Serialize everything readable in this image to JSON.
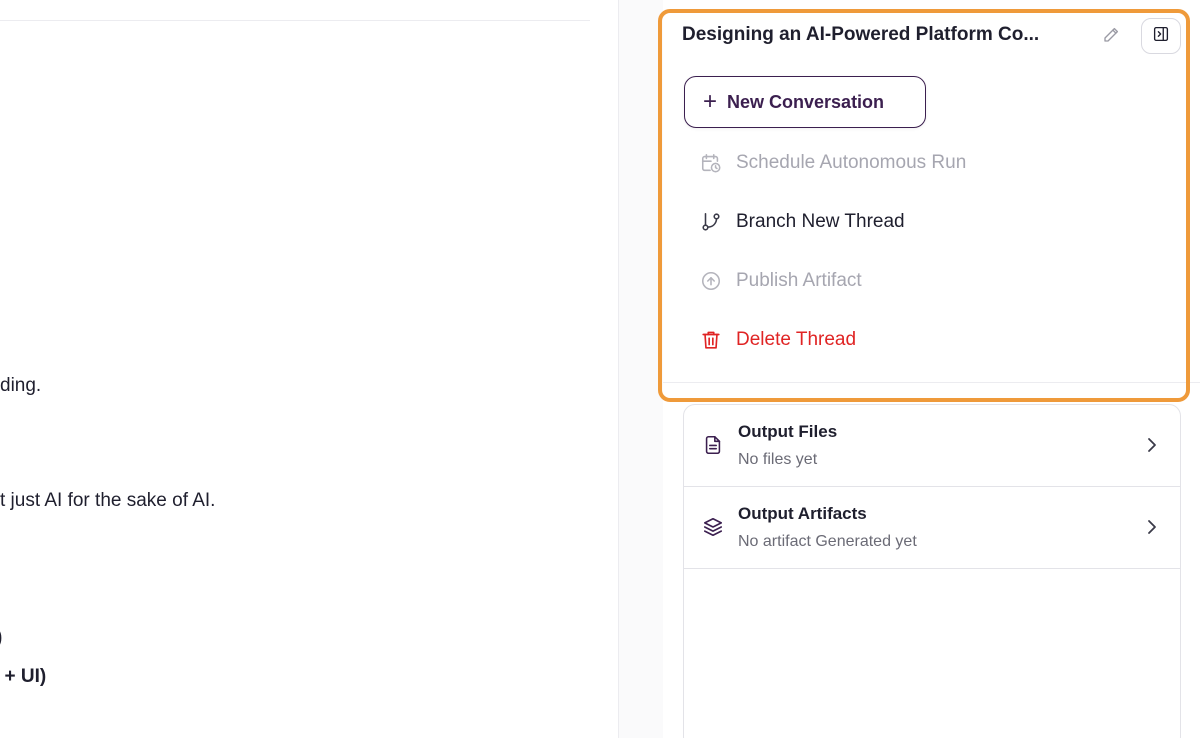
{
  "chat": {
    "lines": [
      "ding.",
      "t just AI for the sake of AI.",
      ")",
      ". + UI)"
    ]
  },
  "sidebar": {
    "thread_title": "Designing an AI-Powered Platform Co...",
    "new_conversation_label": "New Conversation",
    "menu": [
      {
        "label": "Schedule Autonomous Run",
        "icon": "calendar-clock-icon",
        "state": "disabled"
      },
      {
        "label": "Branch New Thread",
        "icon": "git-branch-icon",
        "state": "enabled"
      },
      {
        "label": "Publish Artifact",
        "icon": "upload-circle-icon",
        "state": "disabled"
      },
      {
        "label": "Delete Thread",
        "icon": "trash-icon",
        "state": "danger"
      }
    ],
    "outputs": [
      {
        "title": "Output Files",
        "subtitle": "No files yet",
        "icon": "file-document-icon"
      },
      {
        "title": "Output Artifacts",
        "subtitle": "No artifact Generated yet",
        "icon": "layers-icon"
      }
    ]
  },
  "colors": {
    "accent": "#3b1f4f",
    "danger": "#e02424",
    "disabled": "#a6a6b0",
    "highlight": "#ef9a3a"
  }
}
